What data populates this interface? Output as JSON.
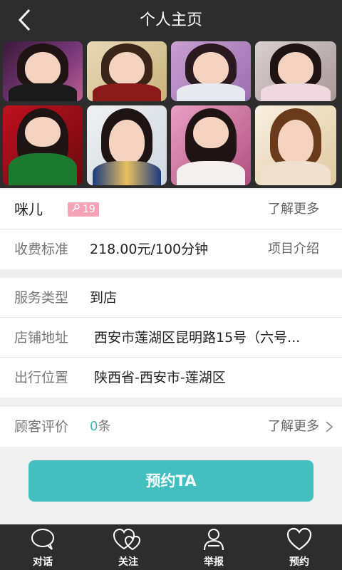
{
  "header": {
    "title": "个人主页",
    "back_icon": "back-arrow-icon"
  },
  "gallery": {
    "photos": [
      {
        "name": "photo-1"
      },
      {
        "name": "photo-2"
      },
      {
        "name": "photo-3"
      },
      {
        "name": "photo-4"
      },
      {
        "name": "photo-5"
      },
      {
        "name": "photo-6"
      },
      {
        "name": "photo-7"
      },
      {
        "name": "photo-8"
      }
    ]
  },
  "profile": {
    "name": "咪儿",
    "age": "19",
    "gender_icon": "female-icon",
    "badge_color": "#f4a3b8",
    "more_link": "了解更多"
  },
  "fee": {
    "label": "收费标准",
    "value": "218.00元/100分钟",
    "link": "项目介绍"
  },
  "service": {
    "type_label": "服务类型",
    "type_value": "到店",
    "address_label": "店铺地址",
    "address_value": "西安市莲湖区昆明路15号（六号...",
    "location_label": "出行位置",
    "location_value": "陕西省-西安市-莲湖区"
  },
  "reviews": {
    "label": "顾客评价",
    "count": "0",
    "unit": "条",
    "link": "了解更多",
    "accent": "#3fb9bd"
  },
  "book_button": {
    "label": "预约TA",
    "color": "#43bfc0"
  },
  "tabbar": {
    "tabs": [
      {
        "label": "对话",
        "icon": "chat-bubble-icon"
      },
      {
        "label": "关注",
        "icon": "heart-follow-icon"
      },
      {
        "label": "举报",
        "icon": "person-report-icon"
      },
      {
        "label": "预约",
        "icon": "heart-book-icon"
      }
    ]
  }
}
